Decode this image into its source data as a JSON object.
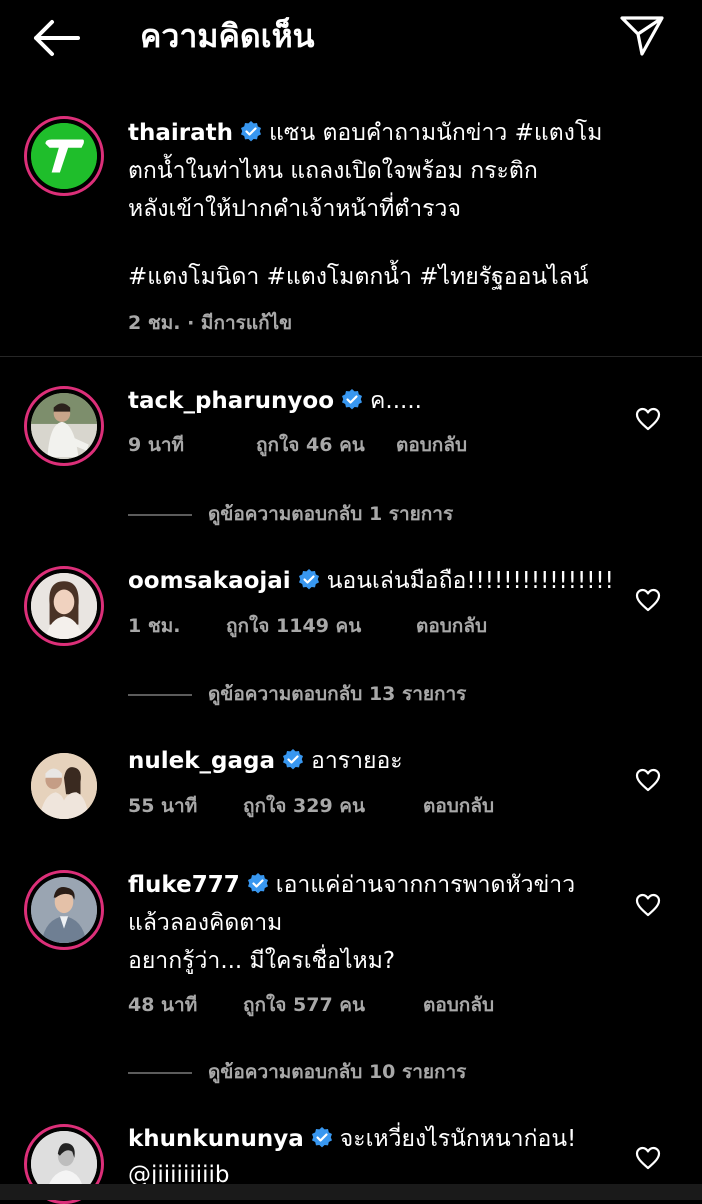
{
  "header": {
    "title": "ความคิดเห็น"
  },
  "post": {
    "username": "thairath",
    "caption_line1": "แซน ตอบคำถามนักข่าว #แตงโม",
    "caption_line2": "ตกน้ำในท่าไหน แถลงเปิดใจพร้อม กระติก",
    "caption_line3": "หลังเข้าให้ปากคำเจ้าหน้าที่ตำรวจ",
    "hashtags": "#แตงโมนิดา #แตงโมตกน้ำ #ไทยรัฐออนไลน์",
    "meta": "2 ชม. · มีการแก้ไข"
  },
  "comments": [
    {
      "username": "tack_pharunyoo",
      "text": "ค.....",
      "time": "9 นาที",
      "likes": "ถูกใจ 46 คน",
      "reply": "ตอบกลับ",
      "view_replies": "ดูข้อความตอบกลับ 1 รายการ"
    },
    {
      "username": "oomsakaojai",
      "text": "นอนเล่นมือถือ!!!!!!!!!!!!!!!!",
      "time": "1 ชม.",
      "likes": "ถูกใจ 1149 คน",
      "reply": "ตอบกลับ",
      "view_replies": "ดูข้อความตอบกลับ 13 รายการ"
    },
    {
      "username": "nulek_gaga",
      "text": "อารายอะ",
      "time": "55 นาที",
      "likes": "ถูกใจ 329 คน",
      "reply": "ตอบกลับ"
    },
    {
      "username": "fluke777",
      "text_line1": "เอาแค่อ่านจากการพาดหัวข่าว",
      "text_line2": "แล้วลองคิดตาม",
      "text_line3": "อยากรู้ว่า...  มีใครเชื่อไหม?",
      "time": "48 นาที",
      "likes": "ถูกใจ 577 คน",
      "reply": "ตอบกลับ",
      "view_replies": "ดูข้อความตอบกลับ 10 รายการ"
    },
    {
      "username": "khunkununya",
      "text": "จะเหวี่ยงไรนักหนาก่อน!",
      "mention": "@jiiiiiiiiib"
    }
  ],
  "colors": {
    "background": "#000000",
    "verified": "#3897f0",
    "story_ring": "#dc2f79",
    "secondary_text": "#a8a8a8",
    "thairath_logo": "#1fbe2b"
  }
}
